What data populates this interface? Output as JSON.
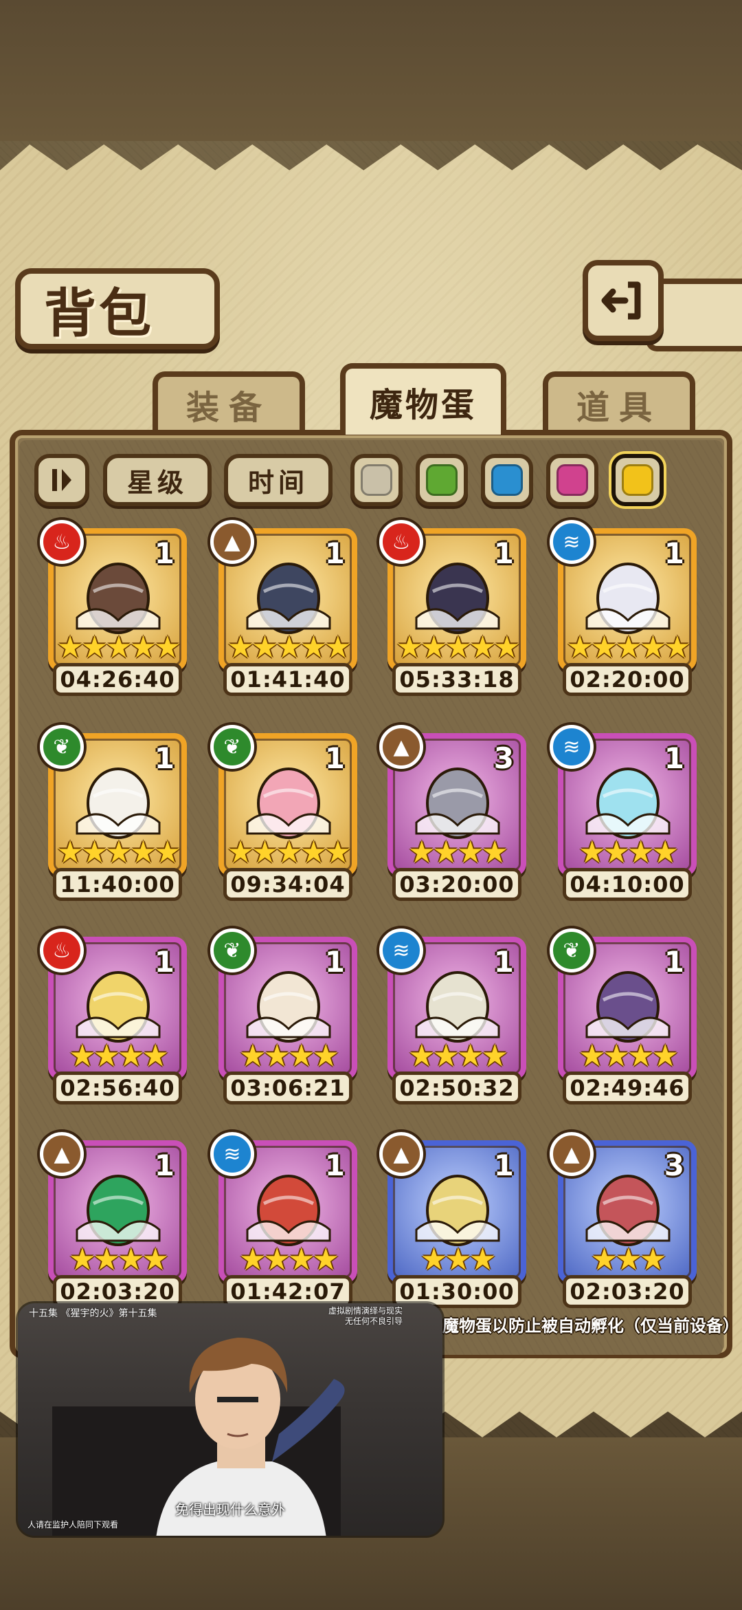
{
  "title": "背包",
  "tabs": [
    {
      "label": "装备",
      "active": false
    },
    {
      "label": "魔物蛋",
      "active": true
    },
    {
      "label": "道具",
      "active": false
    }
  ],
  "filters": {
    "star_label": "星级",
    "time_label": "时间",
    "swatches": [
      "#c9c0a8",
      "#5fa832",
      "#2a8fd0",
      "#d0428e",
      "#f2c21a"
    ],
    "selected_swatch": 4
  },
  "eggs": [
    {
      "element": "fire",
      "count": "1",
      "stars": 5,
      "rarity": "orange",
      "timer": "04:26:40",
      "icon": "bow-quiver-egg"
    },
    {
      "element": "earth",
      "count": "1",
      "stars": 5,
      "rarity": "orange",
      "timer": "01:41:40",
      "icon": "dark-fish-egg"
    },
    {
      "element": "fire",
      "count": "1",
      "stars": 5,
      "rarity": "orange",
      "timer": "05:33:18",
      "icon": "demon-horn-egg"
    },
    {
      "element": "water",
      "count": "1",
      "stars": 5,
      "rarity": "orange",
      "timer": "02:20:00",
      "icon": "feather-cross-egg"
    },
    {
      "element": "grass",
      "count": "1",
      "stars": 5,
      "rarity": "orange",
      "timer": "11:40:00",
      "icon": "angel-wing-egg"
    },
    {
      "element": "grass",
      "count": "1",
      "stars": 5,
      "rarity": "orange",
      "timer": "09:34:04",
      "icon": "pink-pig-egg"
    },
    {
      "element": "earth",
      "count": "3",
      "stars": 4,
      "rarity": "purple",
      "timer": "03:20:00",
      "icon": "sword-egg"
    },
    {
      "element": "water",
      "count": "1",
      "stars": 4,
      "rarity": "purple",
      "timer": "04:10:00",
      "icon": "water-slime-egg"
    },
    {
      "element": "fire",
      "count": "1",
      "stars": 4,
      "rarity": "purple",
      "timer": "02:56:40",
      "icon": "golden-armor-egg"
    },
    {
      "element": "grass",
      "count": "1",
      "stars": 4,
      "rarity": "purple",
      "timer": "03:06:21",
      "icon": "bird-egg"
    },
    {
      "element": "water",
      "count": "1",
      "stars": 4,
      "rarity": "purple",
      "timer": "02:50:32",
      "icon": "leaf-wing-egg"
    },
    {
      "element": "grass",
      "count": "1",
      "stars": 4,
      "rarity": "purple",
      "timer": "02:49:46",
      "icon": "butterfly-egg"
    },
    {
      "element": "earth",
      "count": "1",
      "stars": 4,
      "rarity": "purple",
      "timer": "02:03:20",
      "icon": "green-orb-egg"
    },
    {
      "element": "water",
      "count": "1",
      "stars": 4,
      "rarity": "purple",
      "timer": "01:42:07",
      "icon": "feather-crest-egg"
    },
    {
      "element": "earth",
      "count": "1",
      "stars": 3,
      "rarity": "blue",
      "timer": "01:30:00",
      "icon": "spotted-shell-egg"
    },
    {
      "element": "earth",
      "count": "3",
      "stars": 3,
      "rarity": "blue",
      "timer": "02:03:20",
      "icon": "cat-helmet-egg"
    }
  ],
  "hint": "定魔物蛋以防止被自动孵化（仅当前设备）",
  "video": {
    "top_left": "十五集 《猩宇的火》第十五集",
    "top_right_1": "虚拟剧情演绎与现实",
    "top_right_2": "无任何不良引导",
    "subtitle": "免得出现什么意外",
    "bottom_left": "人请在监护人陪同下观看"
  }
}
